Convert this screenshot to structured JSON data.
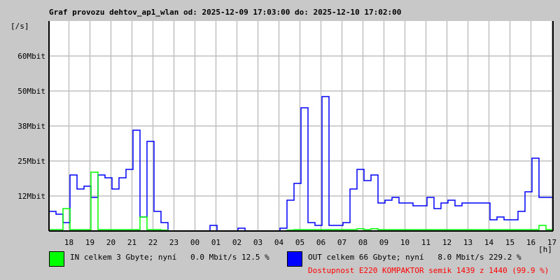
{
  "title": "Graf provozu dehtov_ap1_wlan od: 2025-12-09 17:03:00 do: 2025-12-10 17:02:00",
  "legend": {
    "in_text": "IN celkem 3 Gbyte; nyní   0.0 Mbit/s 12.5 %",
    "out_text": "OUT celkem 66 Gbyte; nyní   8.0 Mbit/s 229.2 %",
    "availability": "Dostupnost E220 KOMPAKTOR semik 1439 z 1440 (99.9 %)",
    "in_color": "#00ff00",
    "out_color": "#0000ff",
    "availability_color": "#ff0000"
  },
  "chart_data": {
    "type": "line",
    "title": "Graf provozu dehtov_ap1_wlan od: 2025-12-09 17:03:00 do: 2025-12-10 17:02:00",
    "ylabel": "[/s]",
    "xlabel": "[h]",
    "ylim": [
      0,
      75
    ],
    "x_unit": "minutes since 17:03, step 20",
    "yticks": [
      {
        "value": 12.5,
        "label": "12Mbit"
      },
      {
        "value": 25,
        "label": "25Mbit"
      },
      {
        "value": 37.5,
        "label": "38Mbit"
      },
      {
        "value": 50,
        "label": "50Mbit"
      },
      {
        "value": 62.5,
        "label": "60Mbit"
      }
    ],
    "xticks": [
      "18",
      "19",
      "20",
      "21",
      "22",
      "23",
      "00",
      "01",
      "02",
      "03",
      "04",
      "05",
      "06",
      "07",
      "08",
      "09",
      "10",
      "11",
      "12",
      "13",
      "14",
      "15",
      "16",
      "17"
    ],
    "grid": true,
    "series": [
      {
        "name": "OUT",
        "color": "#0000ff",
        "values": [
          7,
          6,
          3,
          20,
          15,
          16,
          12,
          20,
          19,
          15,
          19,
          22,
          36,
          5,
          32,
          7,
          3,
          0,
          0,
          0,
          0,
          0,
          0,
          2,
          0,
          0,
          0,
          1,
          0,
          0,
          0,
          0,
          0,
          1,
          11,
          17,
          44,
          3,
          2,
          48,
          2,
          2,
          3,
          15,
          22,
          18,
          20,
          10,
          11,
          12,
          10,
          10,
          9,
          9,
          12,
          8,
          10,
          11,
          9,
          10,
          10,
          10,
          10,
          4,
          5,
          4,
          4,
          7,
          14,
          26,
          12,
          12,
          11
        ]
      },
      {
        "name": "IN",
        "color": "#00ff00",
        "values": [
          0.5,
          0.5,
          8,
          0.5,
          0.5,
          0.5,
          21,
          0.5,
          0.5,
          0.5,
          0.5,
          0.5,
          0.5,
          5,
          0.5,
          0.5,
          0.3,
          0,
          0,
          0,
          0,
          0,
          0,
          0,
          0,
          0,
          0,
          0,
          0,
          0,
          0,
          0,
          0,
          0,
          0.3,
          0.5,
          0.5,
          0.5,
          0.5,
          0.5,
          0.5,
          0.5,
          0.5,
          0.5,
          0.8,
          0.5,
          0.8,
          0.5,
          0.5,
          0.5,
          0.5,
          0.5,
          0.5,
          0.5,
          0.5,
          0.5,
          0.5,
          0.5,
          0.5,
          0.5,
          0.5,
          0.5,
          0.5,
          0.5,
          0.5,
          0.5,
          0.5,
          0.5,
          0.5,
          0.5,
          2,
          0.5,
          0.5
        ]
      }
    ]
  }
}
